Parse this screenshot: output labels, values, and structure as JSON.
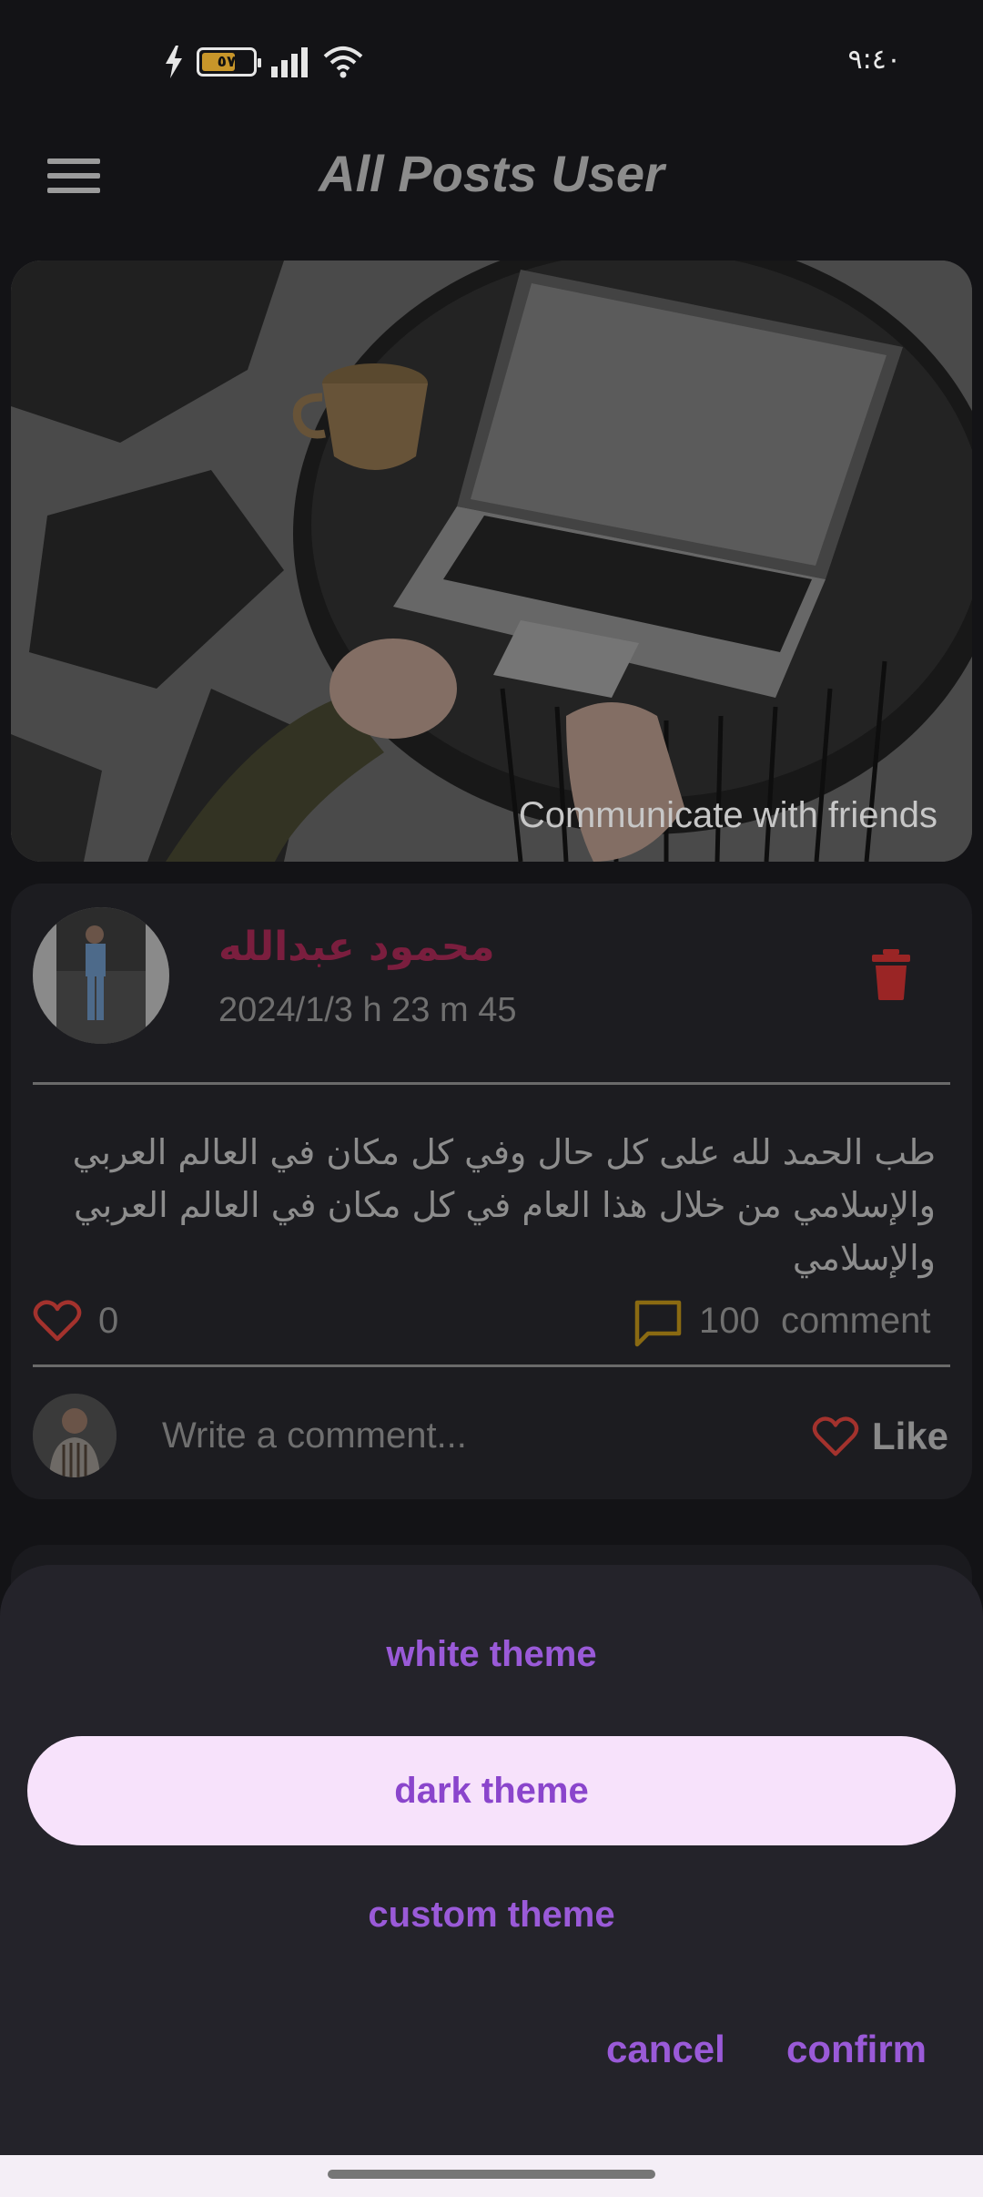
{
  "status_bar": {
    "battery_level": "٥٧",
    "time": "٩:٤٠"
  },
  "app_bar": {
    "title": "All Posts User"
  },
  "banner": {
    "caption": "Communicate with friends"
  },
  "post": {
    "author": "محمود عبدالله",
    "date": "2024/1/3 h 23 m 45",
    "text": "طب الحمد لله على كل حال وفي كل مكان في العالم العربي والإسلامي من خلال هذا العام في كل مكان في العالم العربي والإسلامي",
    "likes": "0",
    "comments_count": "100",
    "comments_label": "comment",
    "comment_placeholder": "Write a comment...",
    "like_label": "Like"
  },
  "theme_sheet": {
    "options": [
      "white theme",
      "dark theme",
      "custom theme"
    ],
    "selected": "dark theme",
    "cancel_label": "cancel",
    "confirm_label": "confirm"
  },
  "colors": {
    "accent": "#9a5ad8",
    "selected_bg": "#f7e2fb",
    "like_red": "#a3322d",
    "comment_gold": "#8a6a12",
    "author": "#7a1e3e"
  }
}
